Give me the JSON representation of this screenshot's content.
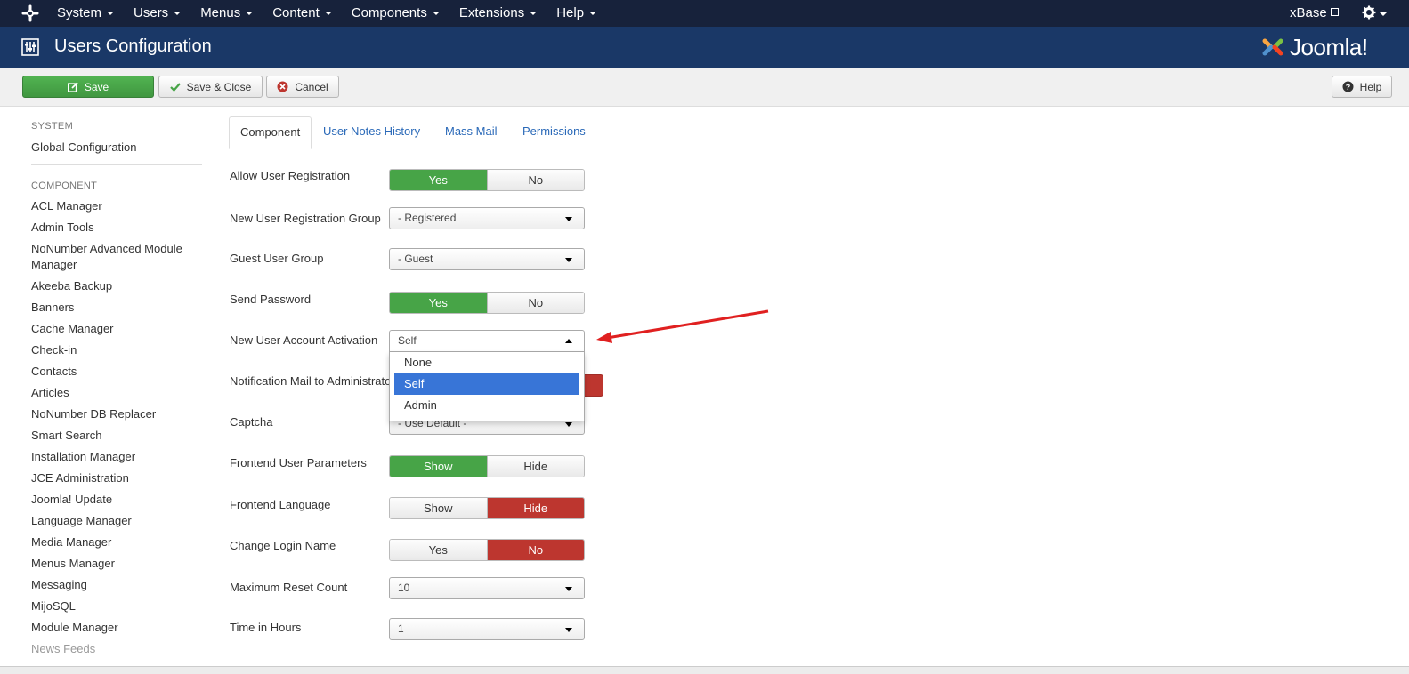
{
  "navbar": {
    "menu": [
      "System",
      "Users",
      "Menus",
      "Content",
      "Components",
      "Extensions",
      "Help"
    ],
    "user": "xBase"
  },
  "header": {
    "title": "Users Configuration",
    "brand": "Joomla!"
  },
  "toolbar": {
    "save": "Save",
    "save_close": "Save & Close",
    "cancel": "Cancel",
    "help": "Help"
  },
  "sidebar": {
    "system_heading": "SYSTEM",
    "global_config": "Global Configuration",
    "component_heading": "COMPONENT",
    "items": [
      "ACL Manager",
      "Admin Tools",
      "NoNumber Advanced Module Manager",
      "Akeeba Backup",
      "Banners",
      "Cache Manager",
      "Check-in",
      "Contacts",
      "Articles",
      "NoNumber DB Replacer",
      "Smart Search",
      "Installation Manager",
      "JCE Administration",
      "Joomla! Update",
      "Language Manager",
      "Media Manager",
      "Menus Manager",
      "Messaging",
      "MijoSQL",
      "Module Manager",
      "News Feeds"
    ]
  },
  "tabs": [
    "Component",
    "User Notes History",
    "Mass Mail",
    "Permissions"
  ],
  "form": {
    "allow_registration": {
      "label": "Allow User Registration",
      "yes": "Yes",
      "no": "No"
    },
    "registration_group": {
      "label": "New User Registration Group",
      "value": "- Registered"
    },
    "guest_group": {
      "label": "Guest User Group",
      "value": "- Guest"
    },
    "send_password": {
      "label": "Send Password",
      "yes": "Yes",
      "no": "No"
    },
    "account_activation": {
      "label": "New User Account Activation",
      "value": "Self",
      "options": [
        "None",
        "Self",
        "Admin"
      ]
    },
    "notification_mail": {
      "label": "Notification Mail to Administrators"
    },
    "captcha": {
      "label": "Captcha",
      "value": "- Use Default -"
    },
    "frontend_params": {
      "label": "Frontend User Parameters",
      "show": "Show",
      "hide": "Hide"
    },
    "frontend_language": {
      "label": "Frontend Language",
      "show": "Show",
      "hide": "Hide"
    },
    "change_login": {
      "label": "Change Login Name",
      "yes": "Yes",
      "no": "No"
    },
    "max_reset": {
      "label": "Maximum Reset Count",
      "value": "10"
    },
    "time_hours": {
      "label": "Time in Hours",
      "value": "1"
    }
  },
  "colors": {
    "navbar": "#17223b",
    "header": "#1a3867",
    "green": "#47a447",
    "red": "#bd362f",
    "link": "#2a69b8",
    "highlight": "#3875d7",
    "annotation": "#e02020"
  }
}
